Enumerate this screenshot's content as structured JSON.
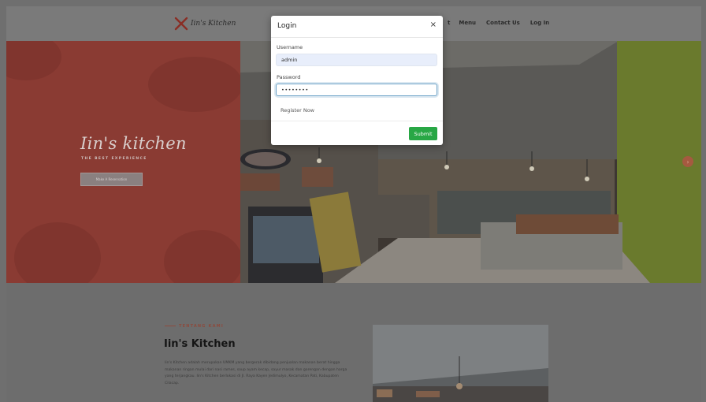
{
  "nav": {
    "brand": "Iin's Kitchen",
    "partial_link": "t",
    "links": [
      "Menu",
      "Contact Us",
      "Log In"
    ]
  },
  "hero": {
    "title": "Iin's kitchen",
    "subtitle": "THE BEST EXPERIENCE",
    "button_label": "Make A Reservation"
  },
  "about": {
    "eyebrow": "TENTANG KAMI",
    "title": "Iin's Kitchen",
    "paragraph": "Iin's Kitchen adalah merupakan UMKM yang bergerak dibidang penjualan makanan berat hingga makanan ringan mulai dari nasi rames, soup ayam kecap, sayur masak dan gorengan dengan harga yang terjangkau. Iin's Kitchen berlokasi di Jl. Raya Kayen Jedimulyo, Kecamatan Pati, Kabupaten Cilacap."
  },
  "login_modal": {
    "title": "Login",
    "close_symbol": "×",
    "username_label": "Username",
    "username_value": "admin",
    "password_label": "Password",
    "password_value": "••••••••",
    "register_label": "Register Now",
    "submit_label": "Submit"
  }
}
